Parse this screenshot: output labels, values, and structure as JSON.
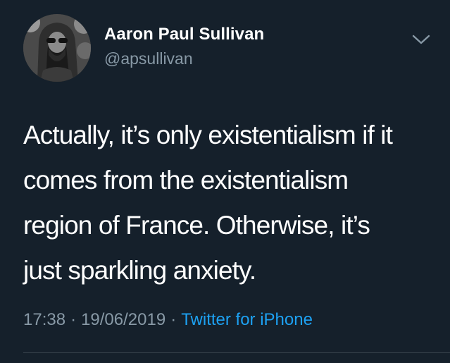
{
  "author": {
    "display_name": "Aaron Paul Sullivan",
    "handle": "@apsullivan",
    "avatar_icon": "profile-photo"
  },
  "menu": {
    "icon": "chevron-down-icon"
  },
  "tweet": {
    "lines": [
      "Actually, it’s only existentialism if it",
      "comes from the existentialism",
      "region of France. Otherwise, it’s",
      "just sparkling anxiety."
    ]
  },
  "meta": {
    "time": "17:38",
    "separator": "·",
    "date": "19/06/2019",
    "source": "Twitter for iPhone"
  },
  "colors": {
    "background": "#15202b",
    "primary_text": "#ffffff",
    "secondary_text": "#8899a6",
    "link": "#1da1f2",
    "divider": "#38444d"
  }
}
